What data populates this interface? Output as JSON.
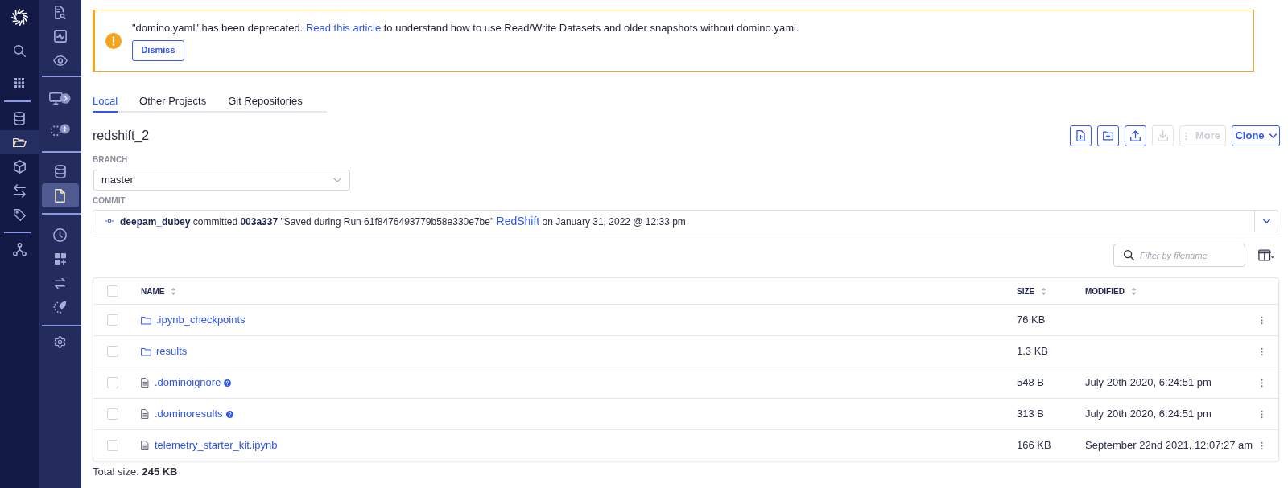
{
  "primary_nav": {
    "groups": [
      {
        "items": [
          {
            "selected": false
          },
          {
            "selected": false
          }
        ]
      },
      {
        "items": [
          {
            "selected": false
          },
          {
            "selected": true
          },
          {
            "selected": false
          },
          {
            "selected": false
          },
          {
            "selected": false
          }
        ]
      },
      {
        "items": [
          {
            "selected": false
          }
        ]
      }
    ]
  },
  "project_nav": {
    "groups": [
      {
        "items": [
          {
            "selected": false
          },
          {
            "selected": false
          },
          {
            "selected": false
          }
        ]
      },
      {
        "items": [
          {
            "selected": false
          },
          {
            "selected": false
          }
        ]
      },
      {
        "items": [
          {
            "selected": false
          },
          {
            "selected": true
          }
        ]
      },
      {
        "items": [
          {
            "selected": false
          },
          {
            "selected": false
          },
          {
            "selected": false
          },
          {
            "selected": false
          }
        ]
      },
      {
        "items": [
          {
            "selected": false
          }
        ]
      }
    ]
  },
  "banner": {
    "message_before": "\"domino.yaml\" has been deprecated.",
    "link": "Read this article",
    "message_after": "to understand how to use Read/Write Datasets and older snapshots without domino.yaml.",
    "dismiss_button": "Dismiss"
  },
  "tabs": [
    {
      "label": "Local",
      "selected": true
    },
    {
      "label": "Other Projects",
      "selected": false
    },
    {
      "label": "Git Repositories",
      "selected": false
    }
  ],
  "repository": {
    "name": "redshift_2"
  },
  "toolbar": [
    {
      "kind": "icon",
      "disabled": false
    },
    {
      "kind": "icon",
      "disabled": false
    },
    {
      "kind": "icon",
      "disabled": false
    },
    {
      "kind": "icon",
      "disabled": true
    },
    {
      "kind": "menu",
      "label": "More",
      "disabled": true
    },
    {
      "kind": "dropdown",
      "label": "Clone",
      "disabled": false
    }
  ],
  "branch": {
    "label": "BRANCH",
    "value": "master"
  },
  "commit": {
    "label": "COMMIT",
    "summary": "**deepam_dubey** committed **003a337** \"Saved during Run 61f8476493779b58e330e7be\"",
    "link": "RedShift",
    "date": "on January 31, 2022 @ 12:33 pm"
  },
  "filter": {
    "placeholder": "Filter by filename"
  },
  "table": {
    "select_all": {
      "checked": false
    },
    "columns": [
      {
        "label": "NAME"
      },
      {
        "label": "SIZE"
      },
      {
        "label": "MODIFIED"
      }
    ],
    "rows": [
      {
        "kind": "folder",
        "name": ".ipynb_checkpoints",
        "help": false,
        "size": "76 KB",
        "checked": false
      },
      {
        "kind": "folder",
        "name": "results",
        "help": false,
        "size": "1.3 KB",
        "checked": false
      },
      {
        "kind": "file",
        "name": ".dominoignore",
        "help": true,
        "size": "548 B",
        "modified": "July 20th 2020, 6:24:51 pm",
        "checked": false
      },
      {
        "kind": "file",
        "name": ".dominoresults",
        "help": true,
        "size": "313 B",
        "modified": "July 20th 2020, 6:24:51 pm",
        "checked": false
      },
      {
        "kind": "file",
        "name": "telemetry_starter_kit.ipynb",
        "help": false,
        "size": "166 KB",
        "modified": "September 22nd 2021, 12:07:27 am",
        "checked": false
      }
    ]
  },
  "footer": {
    "total": "Total size: **245 KB**"
  }
}
